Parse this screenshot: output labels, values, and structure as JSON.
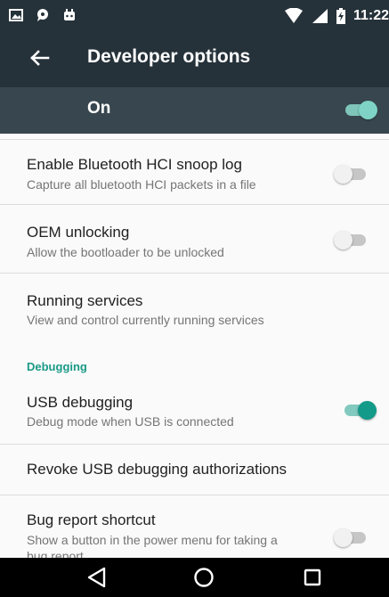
{
  "status_bar": {
    "time": "11:22",
    "icons": [
      "image-icon",
      "chat-icon",
      "android-icon",
      "wifi-icon",
      "signal-icon",
      "battery-charging-icon"
    ]
  },
  "app_bar": {
    "title": "Developer options",
    "back_icon": "back-arrow-icon"
  },
  "master_switch": {
    "label": "On",
    "enabled": true
  },
  "settings": [
    {
      "title": "Enable Bluetooth HCI snoop log",
      "summary": "Capture all bluetooth HCI packets in a file",
      "toggle": false
    },
    {
      "title": "OEM unlocking",
      "summary": "Allow the bootloader to be unlocked",
      "toggle": false
    },
    {
      "title": "Running services",
      "summary": "View and control currently running services"
    },
    {
      "category": "Debugging"
    },
    {
      "title": "USB debugging",
      "summary": "Debug mode when USB is connected",
      "toggle": true
    },
    {
      "title": "Revoke USB debugging authorizations"
    },
    {
      "title": "Bug report shortcut",
      "summary": "Show a button in the power menu for taking a bug report",
      "toggle": false
    }
  ],
  "nav_bar": {
    "icons": [
      "back-triangle-icon",
      "home-circle-icon",
      "recents-square-icon"
    ]
  },
  "colors": {
    "toolbar": "#26323a",
    "master_bar": "#38474f",
    "accent": "#139a88",
    "background": "#fafafa"
  }
}
